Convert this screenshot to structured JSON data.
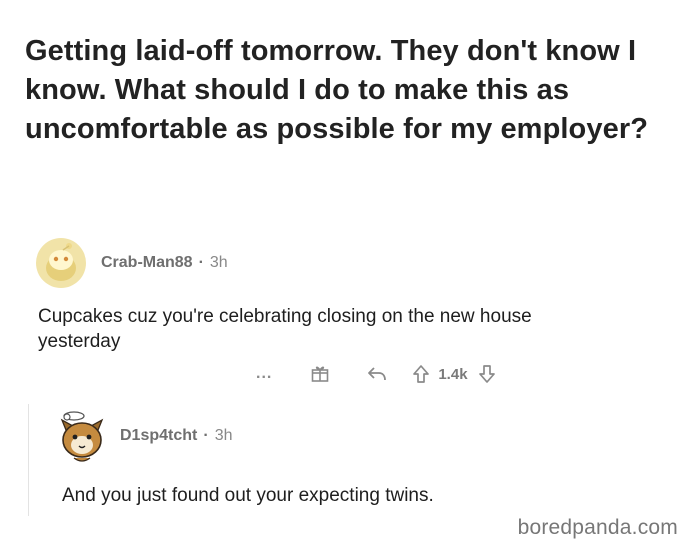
{
  "post": {
    "title": "Getting laid-off tomorrow. They don't know I know. What should I do to make this as uncomfortable as possible for my employer?"
  },
  "comments": [
    {
      "username": "Crab-Man88",
      "separator": "·",
      "age": "3h",
      "text": "Cupcakes cuz you're celebrating closing on the new house yesterday",
      "actions": {
        "more": "...",
        "score": "1.4k"
      }
    },
    {
      "username": "D1sp4tcht",
      "separator": "·",
      "age": "3h",
      "text": "And you just found out your expecting twins."
    }
  ],
  "watermark": "boredpanda.com",
  "icons": {
    "award": "gift-award-icon",
    "reply": "reply-arrow-icon",
    "upvote": "upvote-arrow-icon",
    "downvote": "downvote-arrow-icon"
  }
}
